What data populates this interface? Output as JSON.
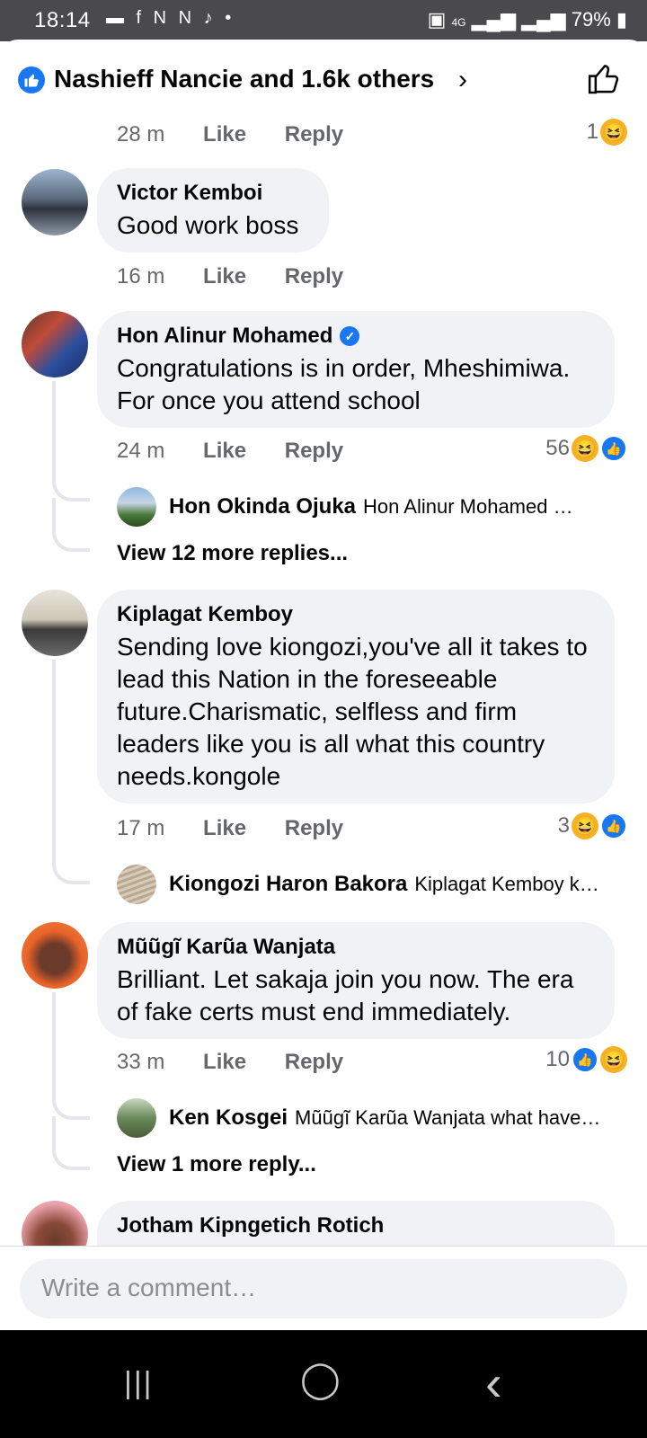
{
  "status": {
    "time": "18:14",
    "left_icons": "▬ f N N ♪ •",
    "network": "4G",
    "battery": "79%"
  },
  "header": {
    "title": "Nashieff Nancie and 1.6k others",
    "chevron": "›"
  },
  "top_meta": {
    "time": "28 m",
    "like": "Like",
    "reply": "Reply",
    "count": "1"
  },
  "comments": [
    {
      "name": "Victor Kemboi",
      "text": "Good work boss",
      "time": "16 m",
      "like": "Like",
      "reply": "Reply"
    },
    {
      "name": "Hon Alinur Mohamed",
      "text": "Congratulations is in order, Mheshimiwa. For once you attend school",
      "time": "24 m",
      "like": "Like",
      "reply": "Reply",
      "count": "56",
      "reply_preview": {
        "name": "Hon Okinda Ojuka",
        "text": "Hon Alinur Mohamed …"
      },
      "view_more": "View 12 more replies..."
    },
    {
      "name": "Kiplagat Kemboy",
      "text": "Sending love kiongozi,you've all it takes to lead this Nation in the foreseeable future.Charismatic, selfless and firm leaders like you is all what this country needs.kongole",
      "time": "17 m",
      "like": "Like",
      "reply": "Reply",
      "count": "3",
      "reply_preview": {
        "name": "Kiongozi Haron Bakora",
        "text": "Kiplagat Kemboy k…"
      }
    },
    {
      "name": "Mũũgĩ Karũa Wanjata",
      "text": "Brilliant. Let sakaja join you now. The era of fake certs must end immediately.",
      "time": "33 m",
      "like": "Like",
      "reply": "Reply",
      "count": "10",
      "reply_preview": {
        "name": "Ken Kosgei",
        "text": "Mũũgĩ Karũa Wanjata what have…"
      },
      "view_more": "View 1 more reply..."
    },
    {
      "name": "Jotham Kipngetich Rotich"
    }
  ],
  "composer": {
    "placeholder": "Write a comment…"
  },
  "nav": {
    "recents": "|||",
    "home": "◯",
    "back": "‹"
  },
  "colors": {
    "brand_blue": "#1877f2",
    "bubble": "#f0f2f5",
    "meta_gray": "#65676b",
    "haha": "#f7b125"
  }
}
